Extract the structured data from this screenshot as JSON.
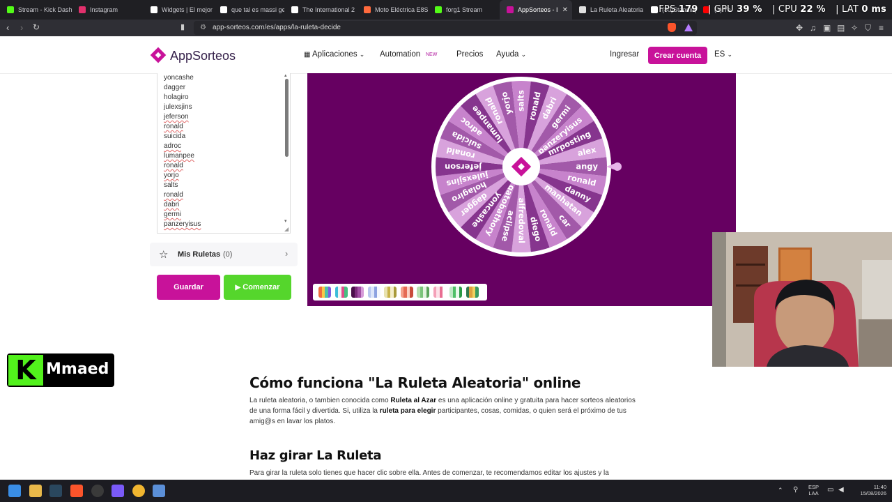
{
  "browser": {
    "tabs": [
      {
        "label": "Stream - Kick Dashb",
        "icon": "kick-icon",
        "color": "#53fc18"
      },
      {
        "label": "Instagram",
        "icon": "instagram-icon",
        "color": "#e1306c"
      },
      {
        "label": "Widgets | El mejor",
        "icon": "widgets-icon",
        "color": "#ffffff"
      },
      {
        "label": "que tal es massi ge",
        "icon": "google-icon",
        "color": "#ffffff"
      },
      {
        "label": "The International 2",
        "icon": "dota-icon",
        "color": "#ffffff"
      },
      {
        "label": "Moto Eléctrica E8S",
        "icon": "brand-icon",
        "color": "#ff6a3d"
      },
      {
        "label": "forg1 Stream",
        "icon": "kick-icon",
        "color": "#53fc18"
      },
      {
        "label": "AppSorteos - I",
        "icon": "appsorteos-icon",
        "color": "#c8129a"
      },
      {
        "label": "La Ruleta Aleatoria",
        "icon": "wheel-icon",
        "color": "#e0e0e0"
      },
      {
        "label": "(80)Standing Dumb",
        "icon": "tiktok-icon",
        "color": "#ffffff"
      },
      {
        "label": "(1) YouTube",
        "icon": "youtube-icon",
        "color": "#ff0000"
      }
    ],
    "url": "app-sorteos.com/es/apps/la-ruleta-decide"
  },
  "stats": {
    "fps_label": "FPS",
    "fps": "179",
    "gpu_label": "GPU",
    "gpu": "39 %",
    "cpu_label": "CPU",
    "cpu": "22 %",
    "lat_label": "LAT",
    "lat": "0 ms"
  },
  "site": {
    "brand": "AppSorteos",
    "nav": {
      "apps": "Aplicaciones",
      "automation": "Automation",
      "new_badge": "NEW",
      "pricing": "Precios",
      "help": "Ayuda",
      "login": "Ingresar",
      "signup": "Crear cuenta",
      "lang": "ES"
    },
    "participants": [
      "yoncashe",
      "dagger",
      "holagiro",
      "julexsjins",
      "jeferson",
      "ronald",
      "suicida",
      "adroc",
      "lumanpee",
      "ronald",
      "yorjo",
      "salts",
      "ronald",
      "dabri",
      "germi",
      "panzeryisus"
    ],
    "mis_ruletas": {
      "label": "Mis Ruletas",
      "count": "(0)"
    },
    "buttons": {
      "save": "Guardar",
      "start": "Comenzar"
    },
    "wheel": {
      "segments": [
        "angy",
        "ronald",
        "danny",
        "manhatan",
        "car",
        "ronald",
        "diego",
        "alfredoval",
        "aclipse",
        "gatobathory",
        "yoncashe",
        "dagger",
        "holagiro",
        "julexsjins",
        "jeferson",
        "ronald",
        "suicida",
        "adroc",
        "lumanpee",
        "ronald",
        "yorjo",
        "salts",
        "ronald",
        "dabri",
        "germi",
        "panzeryisus",
        "mrposting",
        "alex"
      ],
      "colors": [
        "#a259a9",
        "#c783cc",
        "#86358e",
        "#d8a2dc"
      ],
      "background": "#660061"
    },
    "article": {
      "h1": "Cómo funciona \"La Ruleta Aleatoria\" online",
      "p1_a": "La ruleta aleatoria, o tambien conocida como ",
      "p1_b": "Ruleta al Azar",
      "p1_c": " es una aplicación online y gratuita para hacer sorteos aleatorios de una forma fácil y divertida. Si, utiliza la ",
      "p1_d": "ruleta para elegir",
      "p1_e": " participantes, cosas, comidas, o quien será el próximo de tus amig@s en lavar los platos.",
      "h2": "Haz girar La Ruleta",
      "p2": "Para girar la ruleta solo tienes que hacer clic sobre ella. Antes de comenzar, te recomendamos editar los ajustes y la"
    }
  },
  "stream": {
    "channel": "Mmaed"
  },
  "taskbar": {
    "lang1": "ESP",
    "lang2": "LAA",
    "time": "11:40",
    "date": "15/08/2026"
  }
}
